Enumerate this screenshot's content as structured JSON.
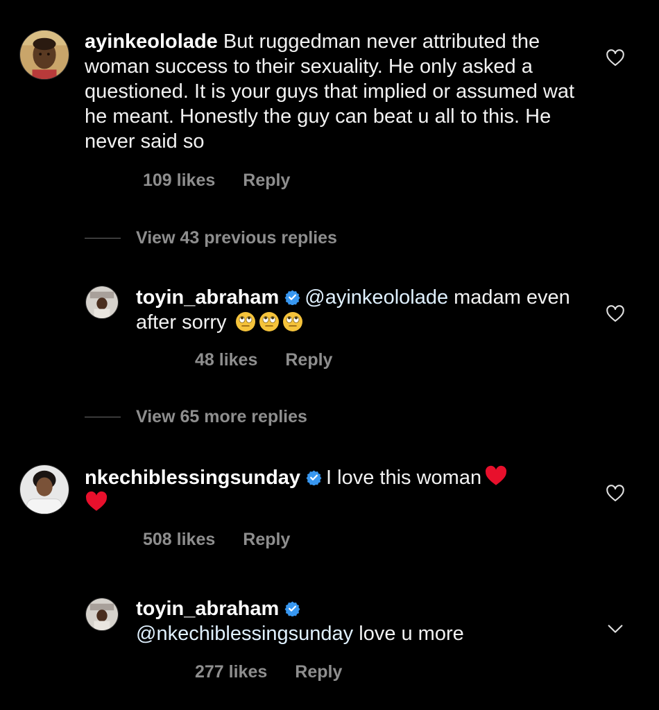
{
  "comments": [
    {
      "username": "ayinkeololade",
      "text": "But ruggedman never attributed the woman success to their sexuality. He only asked a questioned. It is your guys that implied or assumed wat he meant. Honestly the guy can beat u all to this. He never said so",
      "likes": "109 likes",
      "reply": "Reply",
      "view_replies": "View 43 previous replies"
    },
    {
      "username": "toyin_abraham",
      "mention": "@ayinkeololade",
      "text": " madam even after sorry",
      "likes": "48 likes",
      "reply": "Reply",
      "view_replies": "View 65 more replies"
    },
    {
      "username": "nkechiblessingsunday",
      "text": "I love this woman",
      "likes": "508 likes",
      "reply": "Reply"
    },
    {
      "username": "toyin_abraham",
      "mention": "@nkechiblessingsunday",
      "text": " love u more",
      "likes": "277 likes",
      "reply": "Reply"
    }
  ],
  "icons": {
    "like": "heart-outline-icon",
    "verified": "verified-badge-icon",
    "emoji_eye_roll": "eye-roll-emoji",
    "emoji_heart": "red-heart-emoji"
  },
  "colors": {
    "background": "#000000",
    "text": "#f5f5f5",
    "muted": "#8e8e8e",
    "verified": "#3897f0",
    "heart": "#e8102c"
  }
}
